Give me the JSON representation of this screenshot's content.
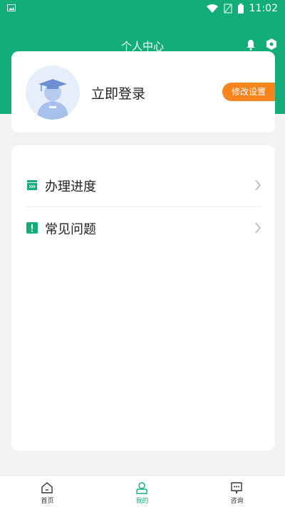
{
  "status_bar": {
    "time": "11:02"
  },
  "header": {
    "title": "个人中心"
  },
  "profile": {
    "login_text": "立即登录",
    "modify_settings_label": "修改设置"
  },
  "menu": {
    "items": [
      {
        "label": "办理进度",
        "icon": "progress-icon"
      },
      {
        "label": "常见问题",
        "icon": "faq-icon"
      }
    ]
  },
  "tabbar": {
    "tabs": [
      {
        "label": "首页",
        "icon": "home-icon"
      },
      {
        "label": "我的",
        "icon": "user-icon",
        "active": true
      },
      {
        "label": "咨询",
        "icon": "consult-icon"
      }
    ]
  },
  "colors": {
    "brand": "#13ad7b",
    "accent": "#f5841d",
    "background": "#f3f3f3"
  }
}
